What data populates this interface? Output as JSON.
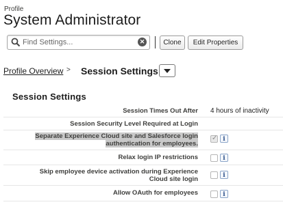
{
  "header": {
    "profile_label": "Profile",
    "title": "System Administrator"
  },
  "toolbar": {
    "search_placeholder": "Find Settings...",
    "clone_label": "Clone",
    "edit_label": "Edit Properties"
  },
  "breadcrumb": {
    "parent": "Profile Overview",
    "separator": ">",
    "current": "Session Settings"
  },
  "section": {
    "title": "Session Settings",
    "rows": [
      {
        "label": "Session Times Out After",
        "value": "4 hours of inactivity"
      },
      {
        "label": "Session Security Level Required at Login",
        "value": ""
      },
      {
        "label_line1": "Separate Experience Cloud site and Salesforce login",
        "label_line2": "authentication for employees.",
        "checked": true
      },
      {
        "label": "Relax login IP restrictions",
        "checked": false
      },
      {
        "label_line1": "Skip employee device activation during Experience",
        "label_line2": "Cloud site login",
        "checked": false
      },
      {
        "label": "Allow OAuth for employees",
        "checked": false
      }
    ],
    "info_glyph": "i"
  }
}
